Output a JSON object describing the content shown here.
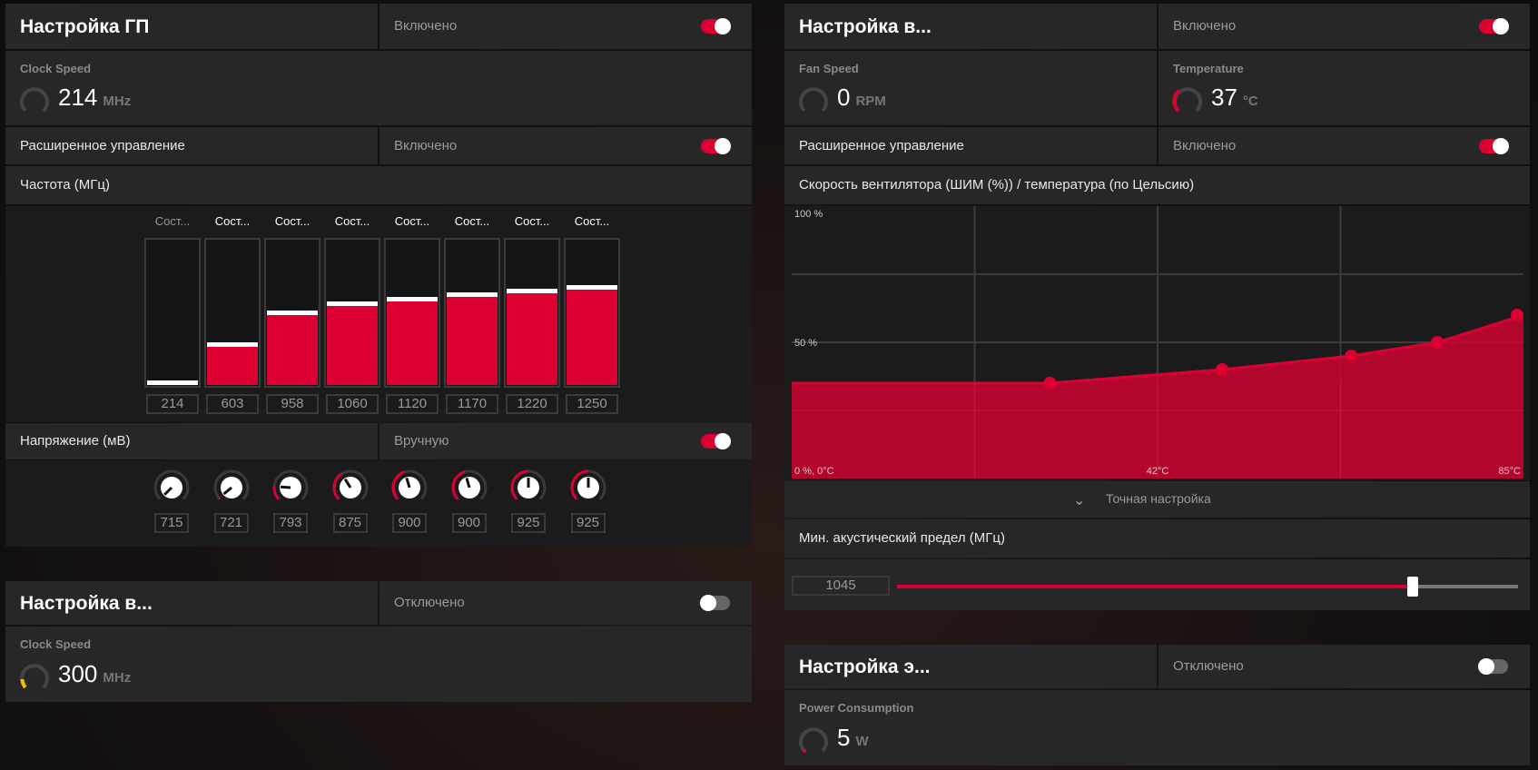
{
  "gpu_tuning": {
    "title": "Настройка ГП",
    "state": "Включено",
    "enabled": true,
    "clock_label": "Clock Speed",
    "clock_value": "214",
    "clock_unit": "MHz",
    "advanced_label": "Расширенное управление",
    "advanced_state": "Включено",
    "advanced_enabled": true,
    "freq_label": "Частота (МГц)",
    "states": [
      {
        "label": "Сост...",
        "value": "214",
        "fill": 0.0
      },
      {
        "label": "Сост...",
        "value": "603",
        "fill": 0.26
      },
      {
        "label": "Сост...",
        "value": "958",
        "fill": 0.48
      },
      {
        "label": "Сост...",
        "value": "1060",
        "fill": 0.54
      },
      {
        "label": "Сост...",
        "value": "1120",
        "fill": 0.57
      },
      {
        "label": "Сост...",
        "value": "1170",
        "fill": 0.6
      },
      {
        "label": "Сост...",
        "value": "1220",
        "fill": 0.63
      },
      {
        "label": "Сост...",
        "value": "1250",
        "fill": 0.65
      }
    ],
    "voltage_label": "Напряжение (мВ)",
    "voltage_mode": "Вручную",
    "voltage_enabled": true,
    "voltages": [
      {
        "value": "715",
        "fill": 0.0
      },
      {
        "value": "721",
        "fill": 0.02
      },
      {
        "value": "793",
        "fill": 0.18
      },
      {
        "value": "875",
        "fill": 0.38
      },
      {
        "value": "900",
        "fill": 0.44
      },
      {
        "value": "900",
        "fill": 0.44
      },
      {
        "value": "925",
        "fill": 0.5
      },
      {
        "value": "925",
        "fill": 0.5
      }
    ]
  },
  "vram_tuning": {
    "title": "Настройка в...",
    "state": "Отключено",
    "enabled": false,
    "clock_label": "Clock Speed",
    "clock_value": "300",
    "clock_unit": "MHz"
  },
  "fan_tuning": {
    "title": "Настройка в...",
    "state": "Включено",
    "enabled": true,
    "fan_label": "Fan Speed",
    "fan_value": "0",
    "fan_unit": "RPM",
    "temp_label": "Temperature",
    "temp_value": "37",
    "temp_unit": "°C",
    "advanced_label": "Расширенное управление",
    "advanced_state": "Включено",
    "advanced_enabled": true,
    "curve_label": "Скорость вентилятора (ШИМ (%)) / температура (по Цельсию)",
    "fine_tune_label": "Точная настройка",
    "min_acoustic_label": "Мин. акустический предел (МГц)",
    "min_acoustic_value": "1045",
    "min_acoustic_fraction": 0.83
  },
  "power_tuning": {
    "title": "Настройка э...",
    "state": "Отключено",
    "enabled": false,
    "power_label": "Power Consumption",
    "power_value": "5",
    "power_unit": "W"
  },
  "chart_data": {
    "type": "area",
    "title": "Скорость вентилятора (ШИМ (%)) / температура (по Цельсию)",
    "xlabel": "°C",
    "ylabel": "%",
    "xlim": [
      0,
      85
    ],
    "ylim": [
      0,
      100
    ],
    "x_tick_labels": [
      "0 %, 0°C",
      "42°C",
      "85°C"
    ],
    "y_tick_labels": [
      "100 %",
      "50 %"
    ],
    "grid": true,
    "points": [
      {
        "x": 30,
        "y": 35
      },
      {
        "x": 50,
        "y": 40
      },
      {
        "x": 65,
        "y": 45
      },
      {
        "x": 75,
        "y": 50
      },
      {
        "x": 85,
        "y": 60
      }
    ],
    "color": "#dc0032"
  }
}
